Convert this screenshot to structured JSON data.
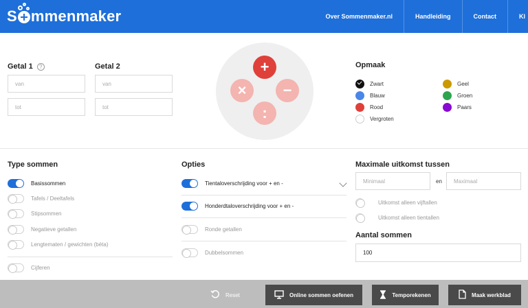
{
  "header": {
    "logo_text_pre": "S",
    "logo_text_post": "mmenmaker",
    "nav": [
      "Over Sommenmaker.nl",
      "Handleiding",
      "Contact",
      "Kl"
    ]
  },
  "getal1": {
    "label": "Getal 1",
    "help": "?",
    "van_placeholder": "van",
    "tot_placeholder": "tot"
  },
  "getal2": {
    "label": "Getal 2",
    "van_placeholder": "van",
    "tot_placeholder": "tot"
  },
  "operations": {
    "plus": "+",
    "times": "×",
    "minus": "−",
    "divide": ":"
  },
  "opmaak": {
    "title": "Opmaak",
    "colors": [
      {
        "name": "Zwart",
        "hex": "#111111",
        "selected": true
      },
      {
        "name": "Blauw",
        "hex": "#4a86e8"
      },
      {
        "name": "Rood",
        "hex": "#e0403a"
      },
      {
        "name": "Vergroten",
        "hex": "#ffffff"
      },
      {
        "name": "Geel",
        "hex": "#cc9900"
      },
      {
        "name": "Groen",
        "hex": "#2ea44f"
      },
      {
        "name": "Paars",
        "hex": "#8a0ad1"
      }
    ]
  },
  "type_sommen": {
    "title": "Type sommen",
    "items": [
      {
        "label": "Basissommen",
        "on": true
      },
      {
        "label": "Tafels / Deeltafels",
        "on": false
      },
      {
        "label": "Stipsommen",
        "on": false
      },
      {
        "label": "Negatieve getallen",
        "on": false
      },
      {
        "label": "Lengtematen / gewichten (bèta)",
        "on": false
      },
      {
        "label": "Cijferen",
        "on": false
      }
    ]
  },
  "opties": {
    "title": "Opties",
    "items": [
      {
        "label": "Tientaloverschrijding voor + en -",
        "on": true
      },
      {
        "label": "Honderdtaloverschrijding voor + en -",
        "on": true
      },
      {
        "label": "Ronde getallen",
        "on": false
      },
      {
        "label": "Dubbelsommen",
        "on": false
      }
    ]
  },
  "maximale": {
    "title": "Maximale uitkomst tussen",
    "min_placeholder": "Minimaal",
    "en": "en",
    "max_placeholder": "Maximaal",
    "options": [
      "Uitkomst alleen vijftallen",
      "Uitkomst alleen tientallen"
    ]
  },
  "aantal": {
    "title": "Aantal sommen",
    "value": "100"
  },
  "bottom": {
    "reset": "Reset",
    "online": "Online sommen oefenen",
    "tempo": "Temporekenen",
    "werkblad": "Maak werkblad"
  },
  "colors": {
    "brand": "#1e6fd9",
    "accent": "#e0403a",
    "dark_button": "#4a4a4a",
    "bottom_bar": "#bdbdbd"
  }
}
